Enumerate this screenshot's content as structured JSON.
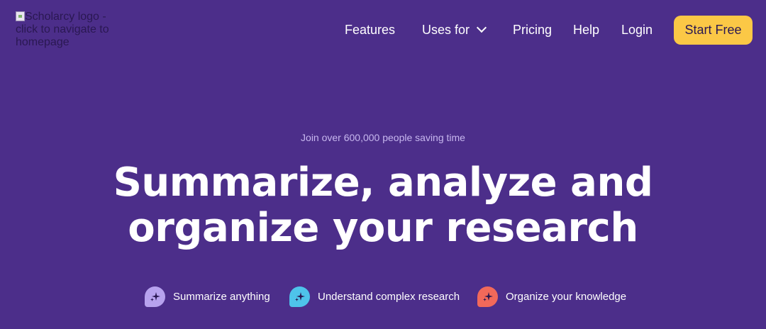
{
  "header": {
    "logo_alt": "Scholarcy logo - click to navigate to homepage",
    "nav": {
      "features": "Features",
      "uses_for": "Uses for",
      "pricing": "Pricing",
      "help": "Help",
      "login": "Login"
    },
    "cta": "Start Free"
  },
  "hero": {
    "kicker": "Join over 600,000 people saving time",
    "headline_line1": "Summarize, analyze and",
    "headline_line2": "organize your research",
    "features": [
      {
        "label": "Summarize anything",
        "icon": "sparkle-icon",
        "color": "#b7a2ee"
      },
      {
        "label": "Understand complex research",
        "icon": "sparkle-icon",
        "color": "#4ec3ea"
      },
      {
        "label": "Organize your knowledge",
        "icon": "sparkle-icon",
        "color": "#f2695a"
      }
    ]
  },
  "colors": {
    "background": "#4c2e8a",
    "accent": "#fbc846",
    "kicker": "#c7b7ef"
  }
}
